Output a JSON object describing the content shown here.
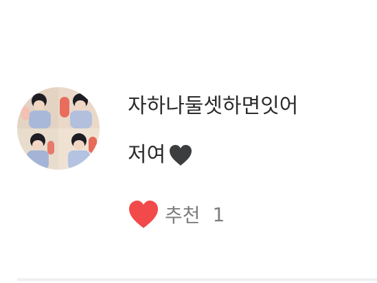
{
  "comment": {
    "avatar_icon": "profile-photo",
    "text_line1": "자하나둘셋하면잇어",
    "text_line2": "저여",
    "text_emoji_icon": "black-heart-icon",
    "like": {
      "icon": "red-heart-icon",
      "label": "추천",
      "count": "1",
      "color": "#f24a4a"
    },
    "text_color": "#2b2b2b",
    "meta_color": "#7d7d7d"
  }
}
